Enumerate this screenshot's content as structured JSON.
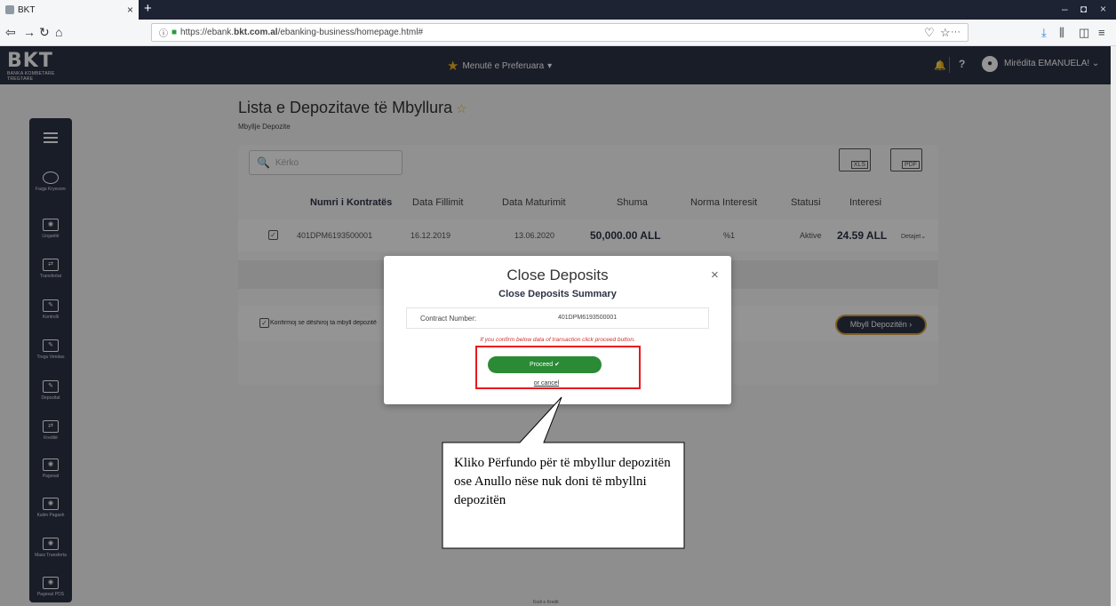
{
  "browser": {
    "tab_title": "BKT",
    "tab_close": "×",
    "new_tab": "+",
    "url_prefix": "https://ebank.",
    "url_domain": "bkt.com.al",
    "url_path": "/ebanking-business/homepage.html#",
    "url_dots": "···",
    "win_min": "–",
    "win_max": "◘",
    "win_close": "×"
  },
  "header": {
    "logo_text": "BKT",
    "logo_subtext": "BANKA KOMBETARE TREGTARE",
    "favorites_label": "Menutë e Preferuara",
    "help": "?",
    "user_name": "Mirëdita EMANUELA!"
  },
  "sidebar": {
    "items": [
      {
        "label": "Faqja Kryesore"
      },
      {
        "label": "Llogaritë"
      },
      {
        "label": "Transfertat"
      },
      {
        "label": "Kontrolli"
      },
      {
        "label": "Tregu Vendas"
      },
      {
        "label": "Depozitat"
      },
      {
        "label": "Kreditë"
      },
      {
        "label": "Pagesat"
      },
      {
        "label": "Kalim Pagash"
      },
      {
        "label": "Mass Transferta"
      },
      {
        "label": "Pagesat POS"
      }
    ]
  },
  "page": {
    "title": "Lista e Depozitave të Mbyllura",
    "subtitle": "Mbyllje Depozite",
    "search_placeholder": "Kërko",
    "export_xls": "XLS",
    "export_pdf": "PDF"
  },
  "table": {
    "columns": [
      "Numri i Kontratës",
      "Data Fillimit",
      "Data Maturimit",
      "Shuma",
      "Norma Interesit",
      "Statusi",
      "Interesi"
    ],
    "row": {
      "contract": "401DPM6193500001",
      "start_date": "16.12.2019",
      "maturity_date": "13.06.2020",
      "amount": "50,000.00 ALL",
      "rate": "%1",
      "status": "Aktive",
      "interest": "24.59 ALL",
      "details": "Detajet"
    }
  },
  "confirm": {
    "text": "Konfirmoj se dëshiroj ta mbyll depozitën",
    "close_button": "Mbyll Depozitën"
  },
  "footer": {
    "text": "Kodi e Kredit"
  },
  "modal": {
    "title": "Close Deposits",
    "subtitle": "Close Deposits Summary",
    "field_label": "Contract Number:",
    "field_value": "401DPM6193500001",
    "note": "If you confirm below data of transaction click proceed button.",
    "proceed": "Proceed",
    "cancel": "or cancel",
    "close": "×"
  },
  "callout": {
    "text": "Kliko Përfundo për të mbyllur depozitën ose Anullo nëse nuk doni të mbyllni depozitën"
  },
  "colors": {
    "header_bg": "#2c3245",
    "accent_star": "#f4b41a",
    "proceed_green": "#2a8a35",
    "highlight_red": "#e8191e"
  }
}
